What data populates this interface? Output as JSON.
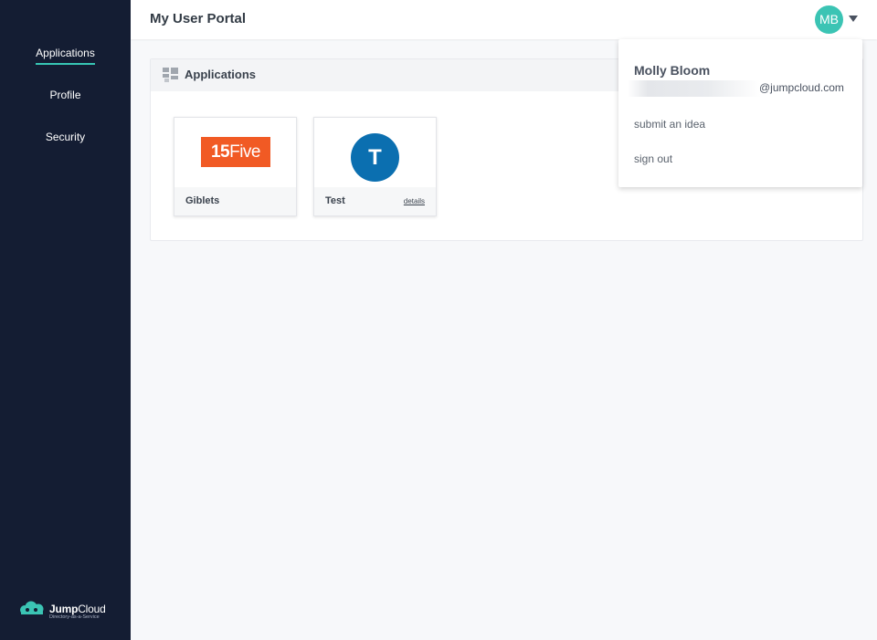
{
  "header": {
    "title": "My User Portal",
    "avatar_initials": "MB"
  },
  "sidebar": {
    "items": [
      {
        "label": "Applications",
        "active": true
      },
      {
        "label": "Profile",
        "active": false
      },
      {
        "label": "Security",
        "active": false
      }
    ],
    "brand": {
      "name_bold": "Jump",
      "name_light": "Cloud",
      "tagline": "Directory-as-a-Service"
    }
  },
  "applications": {
    "title": "Applications",
    "cards": [
      {
        "name": "Giblets",
        "logo_bold": "15",
        "logo_light": "Five"
      },
      {
        "name": "Test",
        "logo_letter": "T",
        "details_label": "details"
      }
    ]
  },
  "user_menu": {
    "name": "Molly Bloom",
    "email_domain": "@jumpcloud.com",
    "items": [
      {
        "label": "submit an idea"
      },
      {
        "label": "sign out"
      }
    ]
  },
  "colors": {
    "sidebar_bg": "#141d33",
    "accent": "#37c6b5",
    "avatar": "#3bc4b4",
    "logo_15five": "#f15a24",
    "logo_test": "#0b6fb0"
  },
  "icons": {
    "applications": "grid-tiles-icon",
    "brand": "cloud-icon",
    "menu": "caret-down-icon"
  }
}
